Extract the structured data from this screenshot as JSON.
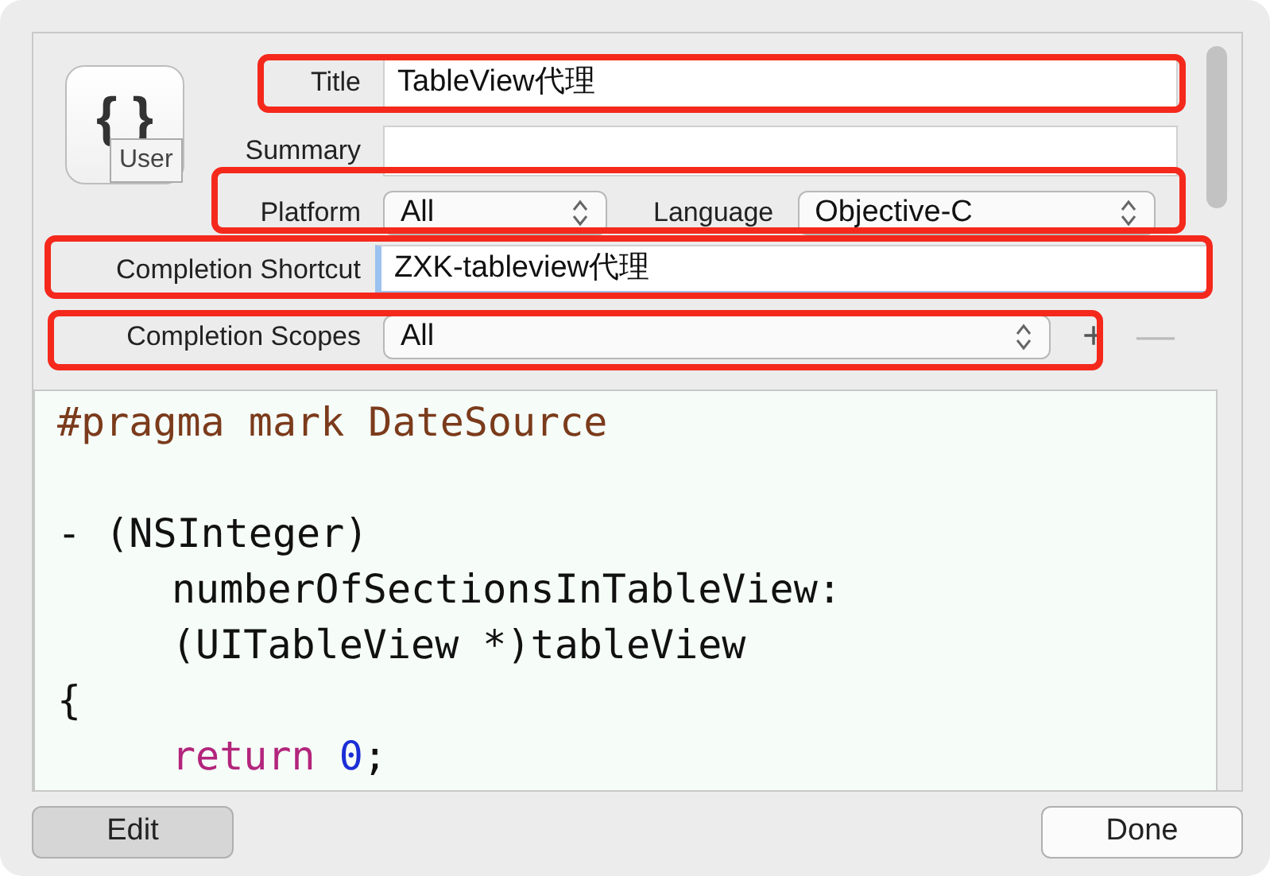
{
  "snippet_icon": {
    "glyph": "{ }",
    "badge": "User"
  },
  "rows": [
    {
      "kind": "text",
      "label": "Title",
      "value": "TableView代理",
      "highlighted": true
    },
    {
      "kind": "text",
      "label": "Summary"
    },
    {
      "kind": "popups",
      "label": "Platform",
      "value": "All",
      "label_2": "Language",
      "value_2": "Objective-C",
      "highlighted": true
    },
    {
      "kind": "text",
      "label": "Completion Shortcut",
      "value": "ZXK-tableview代理",
      "focused": true,
      "highlighted": true
    },
    {
      "kind": "scopes",
      "label": "Completion Scopes",
      "value": "All",
      "add": "+",
      "remove": "—",
      "remove_disabled": true,
      "highlighted": true
    }
  ],
  "code_lines": [
    {
      "indented": false,
      "tokens": [
        {
          "kind": "preprocessor",
          "text": "#pragma mark DateSource"
        }
      ]
    },
    {
      "indented": false,
      "blank_line_before": true,
      "tokens": [
        {
          "kind": "plain",
          "text": "- (NSInteger)"
        }
      ]
    },
    {
      "indented": true,
      "tokens": [
        {
          "kind": "plain",
          "text": "numberOfSectionsInTableView:"
        }
      ]
    },
    {
      "indented": true,
      "tokens": [
        {
          "kind": "plain",
          "text": "(UITableView *)tableView"
        }
      ]
    },
    {
      "indented": false,
      "tokens": [
        {
          "kind": "plain",
          "text": "{"
        }
      ]
    },
    {
      "indented": true,
      "tokens": [
        {
          "kind": "keyword",
          "text": "return"
        },
        {
          "kind": "number",
          "text": "0",
          "gap_before": true
        },
        {
          "kind": "plain",
          "text": ";"
        }
      ]
    }
  ],
  "buttons": [
    {
      "label": "Edit",
      "pressed": true
    },
    {
      "label": "Done",
      "pressed": false
    }
  ]
}
